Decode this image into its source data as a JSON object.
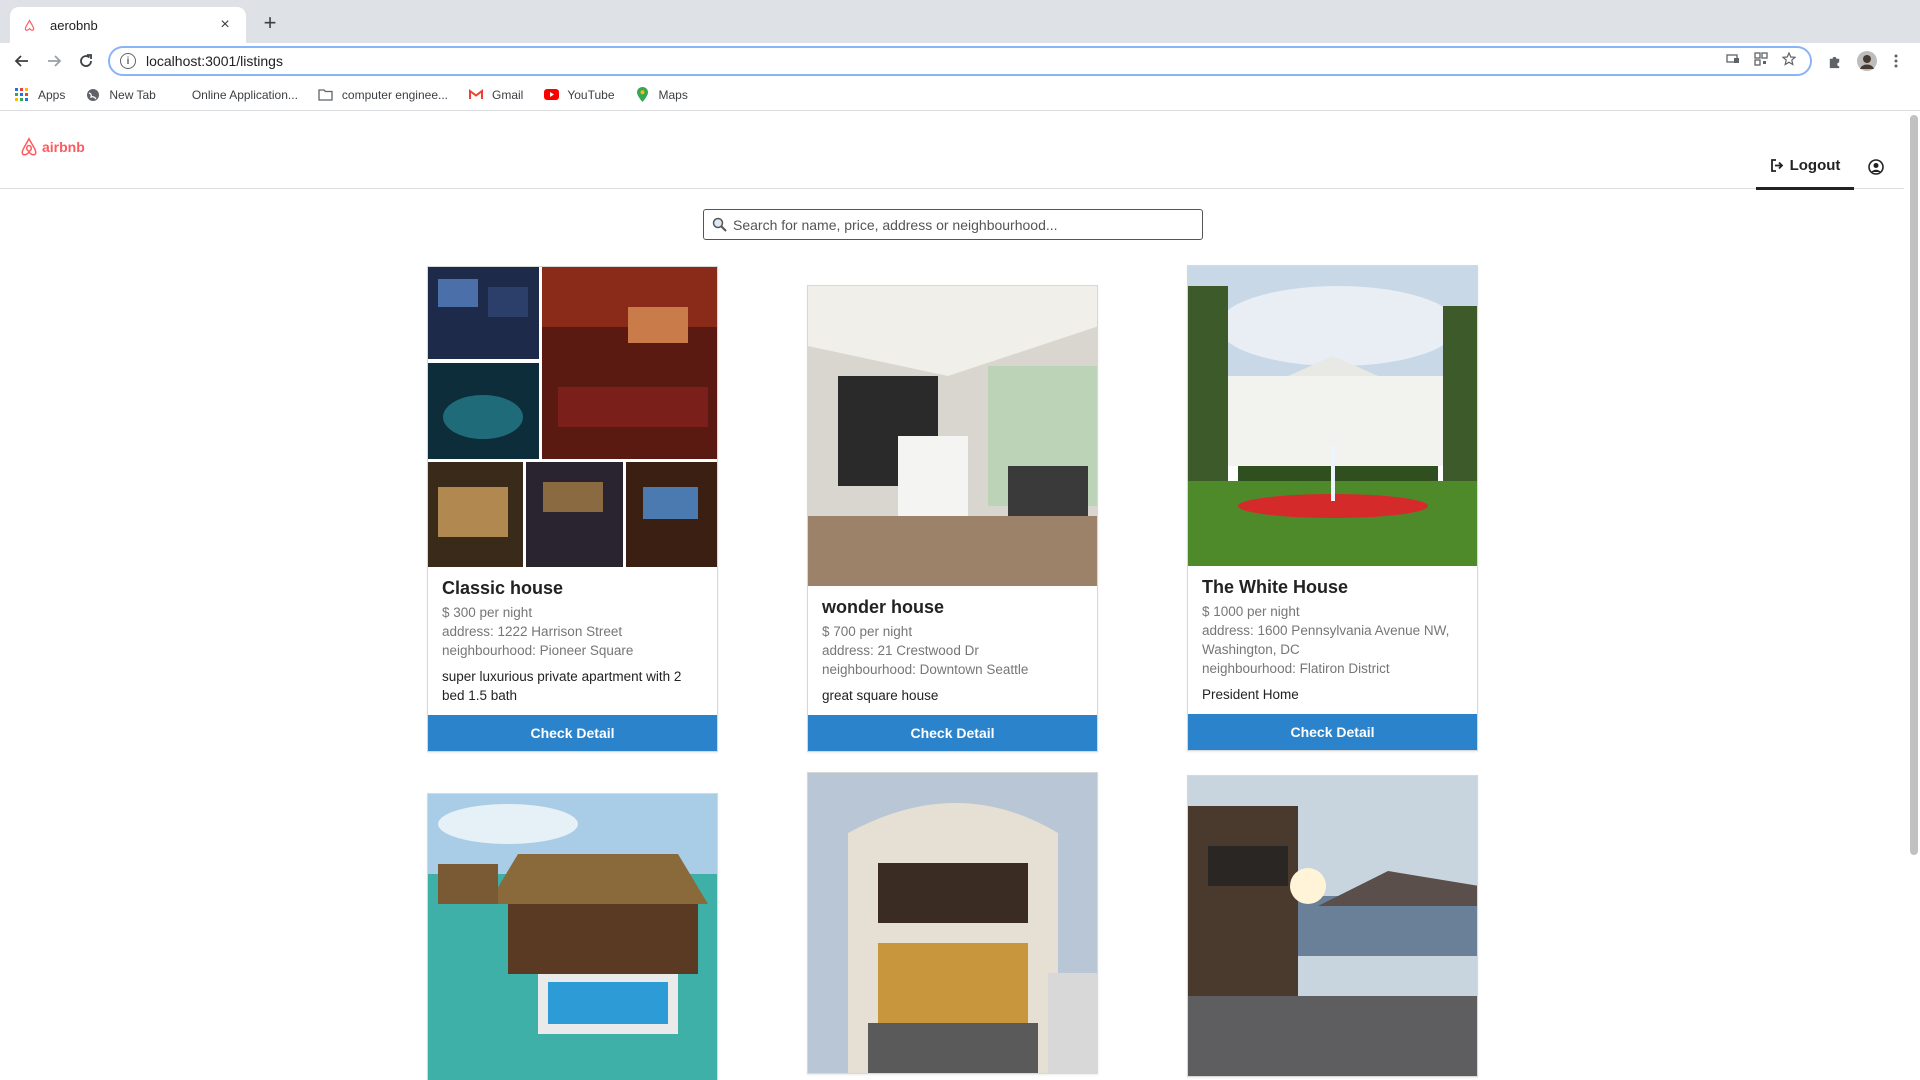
{
  "browser": {
    "tab_title": "aerobnb",
    "tab_close": "×",
    "new_tab": "+",
    "url": "localhost:3001/listings",
    "bookmarks": [
      {
        "label": "Apps",
        "icon": "apps-grid-icon"
      },
      {
        "label": "New Tab",
        "icon": "globe-icon"
      },
      {
        "label": "Online Application...",
        "icon": "blank-page-icon"
      },
      {
        "label": "computer enginee...",
        "icon": "folder-icon"
      },
      {
        "label": "Gmail",
        "icon": "gmail-icon"
      },
      {
        "label": "YouTube",
        "icon": "youtube-icon"
      },
      {
        "label": "Maps",
        "icon": "maps-pin-icon"
      }
    ]
  },
  "header": {
    "logo_text": "airbnb",
    "logout_label": "Logout",
    "accent_color": "#ff5a5f"
  },
  "search": {
    "placeholder": "Search for name, price, address or neighbourhood..."
  },
  "listings": [
    {
      "name": "Classic house",
      "price": "$ 300 per night",
      "address": "address: 1222 Harrison Street",
      "neighbourhood": "neighbourhood: Pioneer Square",
      "description": "super luxurious private apartment with 2 bed 1.5 bath",
      "button": "Check Detail"
    },
    {
      "name": "wonder house",
      "price": "$ 700 per night",
      "address": "address: 21 Crestwood Dr",
      "neighbourhood": "neighbourhood: Downtown Seattle",
      "description": "great square house",
      "button": "Check Detail"
    },
    {
      "name": "The White House",
      "price": "$ 1000 per night",
      "address": "address: 1600 Pennsylvania Avenue NW, Washington, DC",
      "neighbourhood": "neighbourhood: Flatiron District",
      "description": "President Home",
      "button": "Check Detail"
    }
  ],
  "colors": {
    "button_blue": "#2b83cc"
  }
}
